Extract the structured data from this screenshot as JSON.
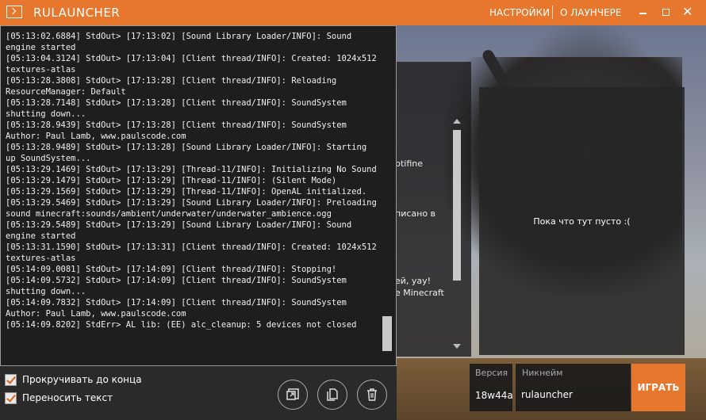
{
  "titlebar": {
    "title": "RULAUNCHER",
    "nav_settings": "НАСТРОЙКИ",
    "nav_about": "О ЛАУНЧЕРЕ"
  },
  "console": {
    "lines": [
      "[05:13:02.6884] StdOut> [17:13:02] [Sound Library Loader/INFO]: Sound engine started",
      "[05:13:04.3124] StdOut> [17:13:04] [Client thread/INFO]: Created: 1024x512 textures-atlas",
      "[05:13:28.3808] StdOut> [17:13:28] [Client thread/INFO]: Reloading ResourceManager: Default",
      "[05:13:28.7148] StdOut> [17:13:28] [Client thread/INFO]: SoundSystem shutting down...",
      "[05:13:28.9439] StdOut> [17:13:28] [Client thread/INFO]: SoundSystem Author: Paul Lamb, www.paulscode.com",
      "[05:13:28.9489] StdOut> [17:13:28] [Sound Library Loader/INFO]: Starting up SoundSystem...",
      "[05:13:29.1469] StdOut> [17:13:29] [Thread-11/INFO]: Initializing No Sound",
      "[05:13:29.1479] StdOut> [17:13:29] [Thread-11/INFO]: (Silent Mode)",
      "[05:13:29.1569] StdOut> [17:13:29] [Thread-11/INFO]: OpenAL initialized.",
      "[05:13:29.5469] StdOut> [17:13:29] [Sound Library Loader/INFO]: Preloading sound minecraft:sounds/ambient/underwater/underwater_ambience.ogg",
      "[05:13:29.5489] StdOut> [17:13:29] [Sound Library Loader/INFO]: Sound engine started",
      "[05:13:31.1590] StdOut> [17:13:31] [Client thread/INFO]: Created: 1024x512 textures-atlas",
      "[05:14:09.0081] StdOut> [17:14:09] [Client thread/INFO]: Stopping!",
      "[05:14:09.5732] StdOut> [17:14:09] [Client thread/INFO]: SoundSystem shutting down...",
      "[05:14:09.7832] StdOut> [17:14:09] [Client thread/INFO]: SoundSystem Author: Paul Lamb, www.paulscode.com",
      "[05:14:09.8202] StdErr> AL lib: (EE) alc_cleanup: 5 devices not closed"
    ],
    "autoscroll_label": "Прокручивать до конца",
    "wrap_label": "Переносить текст",
    "autoscroll_checked": true,
    "wrap_checked": true
  },
  "news": {
    "fragments": [
      "ptifine",
      "писано в",
      "ей, yay!",
      "e Minecraft"
    ]
  },
  "empty_panel": {
    "text": "Пока что тут пусто :("
  },
  "launch": {
    "version_label": "Версия",
    "version_value": "18w44a",
    "nickname_label": "Никнейм",
    "nickname_value": "rulauncher",
    "play_label": "ИГРАТЬ"
  },
  "icons": {
    "open_folder": "open-external-icon",
    "copy": "copy-icon",
    "clear": "trash-icon"
  },
  "colors": {
    "accent": "#e8772e",
    "console_bg": "#1e1e1e"
  }
}
